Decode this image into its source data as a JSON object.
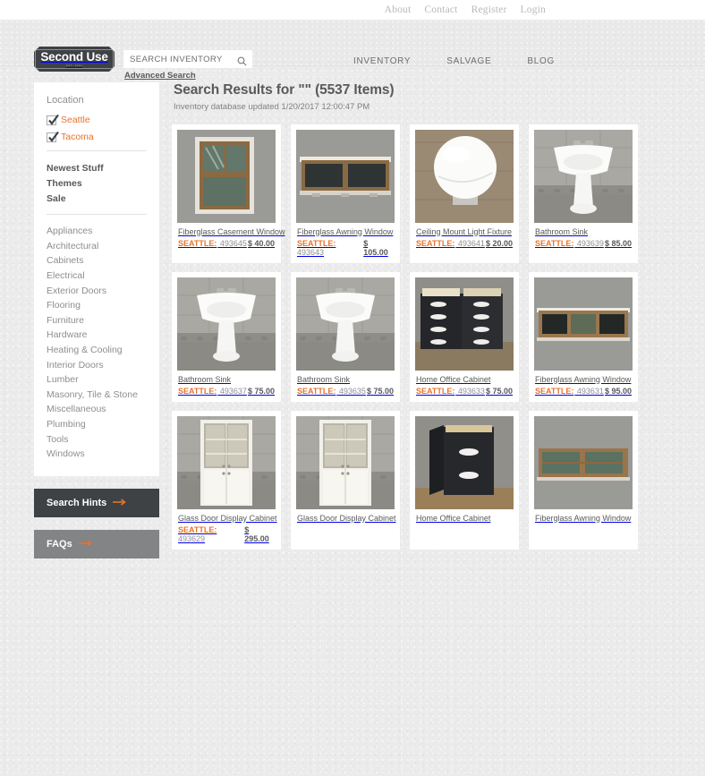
{
  "topnav": {
    "items": [
      {
        "label": "About"
      },
      {
        "label": "Contact"
      },
      {
        "label": "Register"
      },
      {
        "label": "Login"
      }
    ]
  },
  "header": {
    "logo_text": "Second Use",
    "logo_sub": "EST. 1994",
    "search": {
      "placeholder": "SEARCH INVENTORY",
      "value": "",
      "icon": "search-icon",
      "advanced_label": "Advanced Search"
    },
    "nav": [
      {
        "label": "INVENTORY"
      },
      {
        "label": "SALVAGE"
      },
      {
        "label": "BLOG"
      }
    ]
  },
  "sidebar": {
    "location_heading": "Location",
    "locations": [
      {
        "label": "Seattle",
        "checked": true
      },
      {
        "label": "Tacoma",
        "checked": true
      }
    ],
    "links": [
      {
        "label": "Newest Stuff"
      },
      {
        "label": "Themes"
      },
      {
        "label": "Sale"
      }
    ],
    "categories": [
      {
        "label": "Appliances"
      },
      {
        "label": "Architectural"
      },
      {
        "label": "Cabinets"
      },
      {
        "label": "Electrical"
      },
      {
        "label": "Exterior Doors"
      },
      {
        "label": "Flooring"
      },
      {
        "label": "Furniture"
      },
      {
        "label": "Hardware"
      },
      {
        "label": "Heating & Cooling"
      },
      {
        "label": "Interior Doors"
      },
      {
        "label": "Lumber"
      },
      {
        "label": "Masonry, Tile & Stone"
      },
      {
        "label": "Miscellaneous"
      },
      {
        "label": "Plumbing"
      },
      {
        "label": "Tools"
      },
      {
        "label": "Windows"
      }
    ],
    "buttons": [
      {
        "label": "Search Hints",
        "style": "dark"
      },
      {
        "label": "FAQs",
        "style": "gray"
      }
    ]
  },
  "results": {
    "title": "Search Results for \"\" (5537 Items)",
    "subtitle": "Inventory database updated 1/20/2017 12:00:47 PM",
    "items": [
      {
        "title": "Fiberglass Casement Window",
        "city": "SEATTLE:",
        "sku": "493645",
        "price": "$ 40.00",
        "photo": "window-casement"
      },
      {
        "title": "Fiberglass Awning Window",
        "city": "SEATTLE:",
        "sku": "493643",
        "price": "$ 105.00",
        "photo": "window-awning-dark"
      },
      {
        "title": "Ceiling Mount Light Fixture",
        "city": "SEATTLE:",
        "sku": "493641",
        "price": "$ 20.00",
        "photo": "globe-light"
      },
      {
        "title": "Bathroom Sink",
        "city": "SEATTLE:",
        "sku": "493639",
        "price": "$ 85.00",
        "photo": "pedestal-sink"
      },
      {
        "title": "Bathroom Sink",
        "city": "SEATTLE:",
        "sku": "493637",
        "price": "$ 75.00",
        "photo": "pedestal-sink"
      },
      {
        "title": "Bathroom Sink",
        "city": "SEATTLE:",
        "sku": "493635",
        "price": "$ 75.00",
        "photo": "pedestal-sink"
      },
      {
        "title": "Home Office Cabinet",
        "city": "SEATTLE:",
        "sku": "493633",
        "price": "$ 75.00",
        "photo": "black-drawers"
      },
      {
        "title": "Fiberglass Awning Window",
        "city": "SEATTLE:",
        "sku": "493631",
        "price": "$ 95.00",
        "photo": "window-awning-wide"
      },
      {
        "title": "Glass Door Display Cabinet",
        "city": "SEATTLE:",
        "sku": "493629",
        "price": "$ 295.00",
        "photo": "display-cabinet"
      },
      {
        "title": "Glass Door Display Cabinet",
        "city": "",
        "sku": "",
        "price": "",
        "photo": "display-cabinet"
      },
      {
        "title": "Home Office Cabinet",
        "city": "",
        "sku": "",
        "price": "",
        "photo": "black-cabinet-open"
      },
      {
        "title": "Fiberglass Awning Window",
        "city": "",
        "sku": "",
        "price": "",
        "photo": "window-awning-green"
      }
    ]
  },
  "colors": {
    "accent": "#e8732a",
    "dark": "#3e4244",
    "gray": "#828486",
    "text": "#58595b",
    "muted": "#8d8e90",
    "page_bg": "#ebebeb"
  }
}
